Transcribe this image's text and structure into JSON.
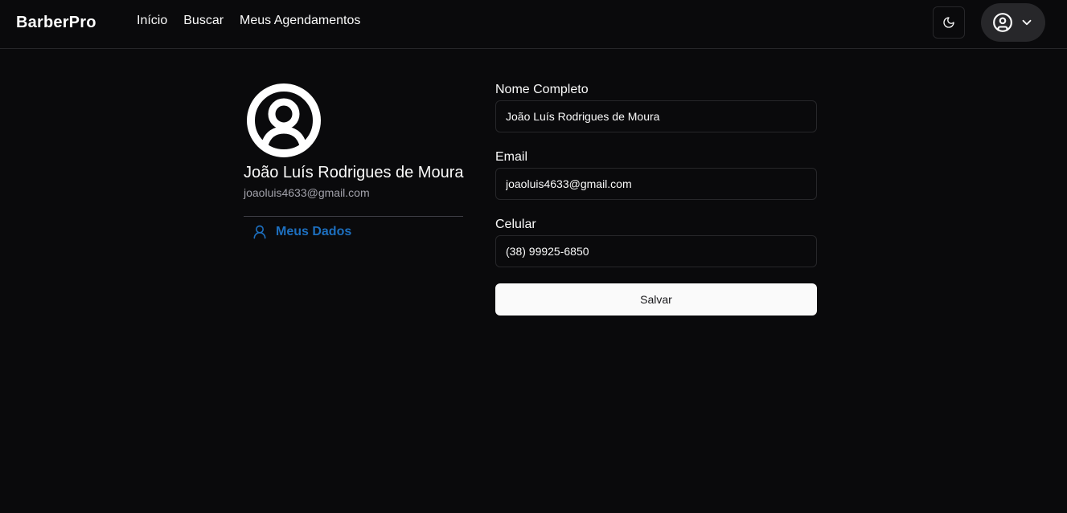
{
  "header": {
    "logo": "BarberPro",
    "nav": [
      {
        "label": "Início"
      },
      {
        "label": "Buscar"
      },
      {
        "label": "Meus Agendamentos"
      }
    ],
    "theme_toggle_icon": "moon-icon",
    "user_menu_icons": [
      "user-circle-icon",
      "chevron-down-icon"
    ]
  },
  "profile": {
    "avatar_icon": "user-circle-icon",
    "name": "João Luís Rodrigues de Moura",
    "email": "joaoluis4633@gmail.com",
    "menu": [
      {
        "label": "Meus Dados",
        "icon": "user-icon",
        "active": true
      }
    ]
  },
  "form": {
    "fields": [
      {
        "label": "Nome Completo",
        "value": "João Luís Rodrigues de Moura"
      },
      {
        "label": "Email",
        "value": "joaoluis4633@gmail.com"
      },
      {
        "label": "Celular",
        "value": "(38) 99925-6850"
      }
    ],
    "save_label": "Salvar"
  },
  "colors": {
    "background": "#0a0a0c",
    "border": "#27272a",
    "accent": "#1d6fbf",
    "text": "#fafafa",
    "muted": "#a1a1aa"
  }
}
